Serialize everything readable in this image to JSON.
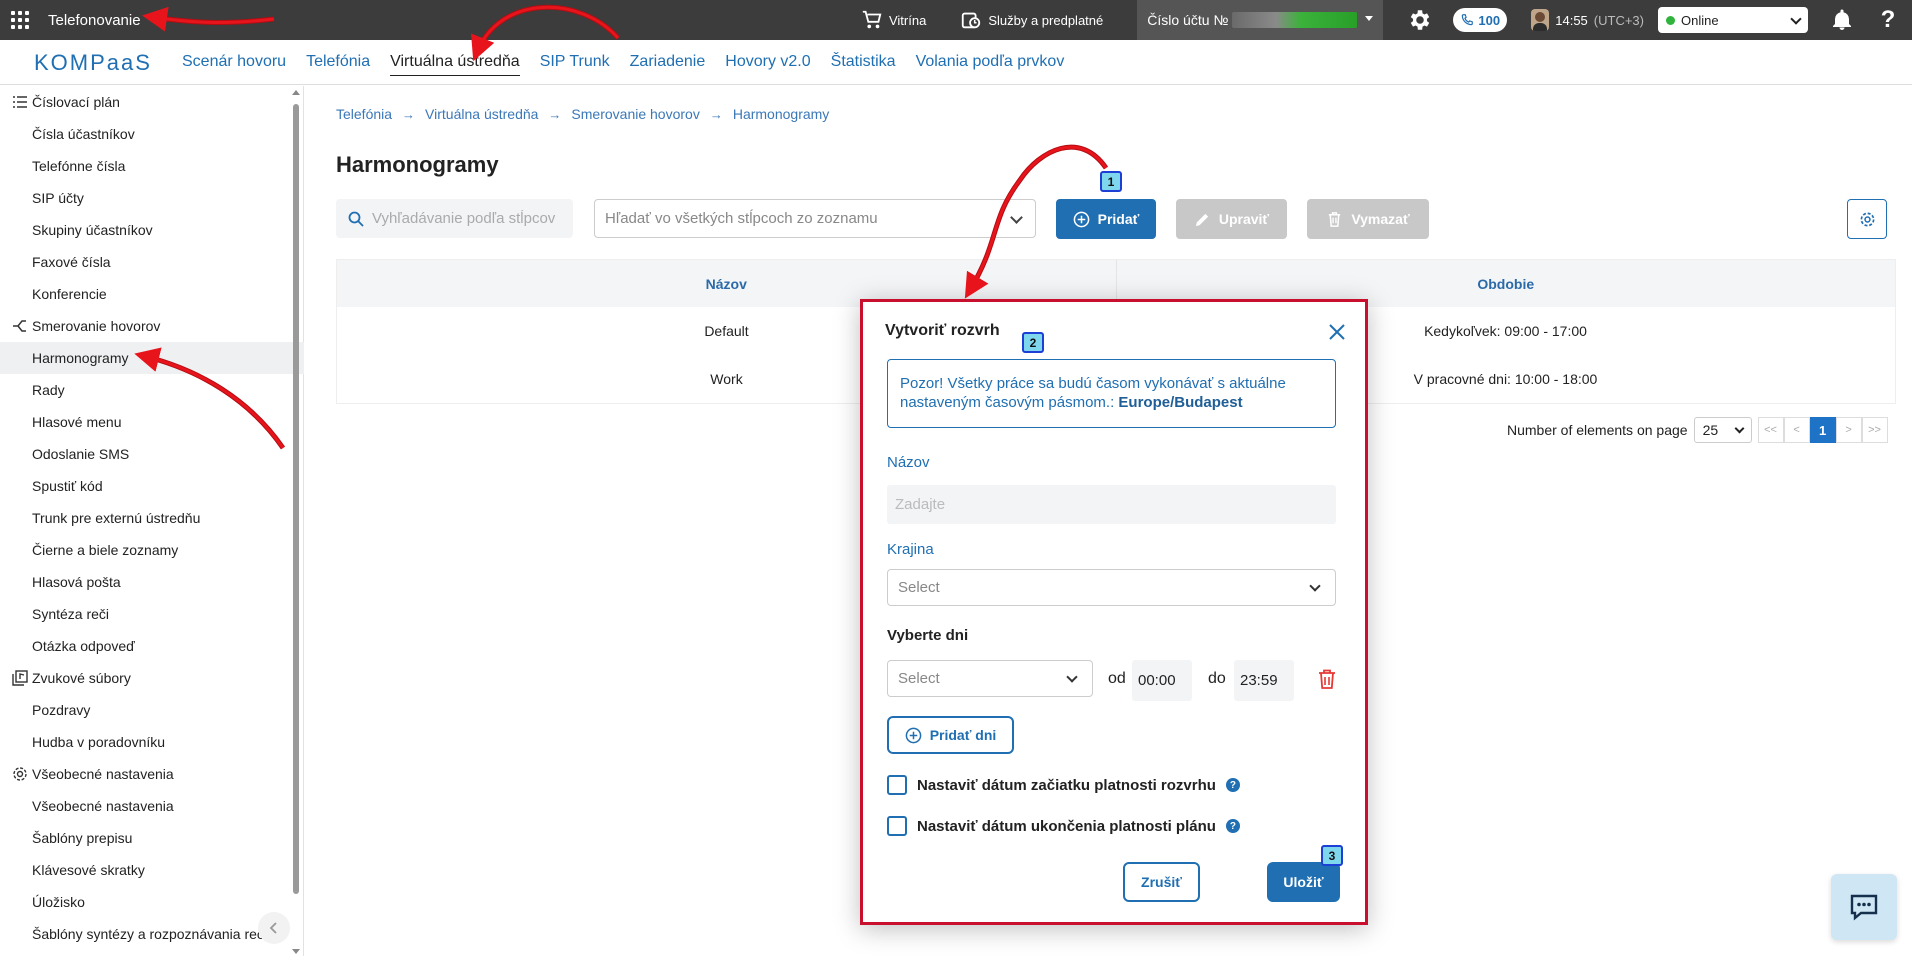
{
  "topbar": {
    "app_title": "Telefonovanie",
    "vitrina": "Vitrína",
    "services": "Služby a predplatné",
    "account_label": "Číslo účtu №",
    "calls_count": "100",
    "time": "14:55",
    "timezone": "(UTC+3)",
    "status": "Online",
    "help": "?"
  },
  "nav": {
    "logo": "KOMPaaS",
    "items": [
      "Scenár hovoru",
      "Telefónia",
      "Virtuálna ústredňa",
      "SIP Trunk",
      "Zariadenie",
      "Hovory v2.0",
      "Štatistika",
      "Volania podľa prvkov"
    ],
    "active_index": 2
  },
  "sidebar": {
    "group_numbering": "Číslovací plán",
    "numbering_items": [
      "Čísla účastníkov",
      "Telefónne čísla",
      "SIP účty",
      "Skupiny účastníkov",
      "Faxové čísla",
      "Konferencie"
    ],
    "group_routing": "Smerovanie hovorov",
    "routing_items": [
      "Harmonogramy",
      "Rady",
      "Hlasové menu",
      "Odoslanie SMS",
      "Spustiť kód",
      "Trunk pre externú ústredňu",
      "Čierne a biele zoznamy",
      "Hlasová pošta",
      "Syntéza reči",
      "Otázka odpoveď"
    ],
    "group_sound": "Zvukové súbory",
    "sound_items": [
      "Pozdravy",
      "Hudba v poradovníku"
    ],
    "group_general": "Všeobecné nastavenia",
    "general_items": [
      "Všeobecné nastavenia",
      "Šablóny prepisu",
      "Klávesové skratky",
      "Úložisko",
      "Šablóny syntézy a rozpoznávania reč."
    ]
  },
  "breadcrumb": [
    "Telefónia",
    "Virtuálna ústredňa",
    "Smerovanie hovorov",
    "Harmonogramy"
  ],
  "page_title": "Harmonogramy",
  "toolbar": {
    "search_placeholder": "Vyhľadávanie podľa stĺpcov",
    "search_all_placeholder": "Hľadať vo všetkých stĺpcoch zo zoznamu",
    "add": "Pridať",
    "edit": "Upraviť",
    "delete": "Vymazať"
  },
  "table": {
    "headers": [
      "Názov",
      "Obdobie"
    ],
    "rows": [
      [
        "Default",
        "Kedykoľvek: 09:00 - 17:00"
      ],
      [
        "Work",
        "V pracovné dni: 10:00 - 18:00"
      ]
    ]
  },
  "pager": {
    "label": "Number of elements on page",
    "page_size": "25",
    "first": "<<",
    "prev": "<",
    "current": "1",
    "next": ">",
    "last": ">>"
  },
  "modal": {
    "title": "Vytvoriť rozvrh",
    "notice_text": "Pozor! Všetky práce sa budú časom vykonávať s aktuálne nastaveným časovým pásmom.:",
    "notice_tz": "Europe/Budapest",
    "name_label": "Názov",
    "name_placeholder": "Zadajte",
    "country_label": "Krajina",
    "country_placeholder": "Select",
    "days_label": "Vyberte dni",
    "day_placeholder": "Select",
    "from_label": "od",
    "from_value": "00:00",
    "to_label": "do",
    "to_value": "23:59",
    "add_days": "Pridať dni",
    "start_date_label": "Nastaviť dátum začiatku platnosti rozvrhu",
    "end_date_label": "Nastaviť dátum ukončenia platnosti plánu",
    "help_mark": "?",
    "cancel": "Zrušiť",
    "save": "Uložiť"
  },
  "steps": [
    "1",
    "2",
    "3"
  ],
  "colors": {
    "accent": "#1f6fb2",
    "topbar": "#3c3c3c",
    "annotation_red": "#e8141c",
    "modal_border": "#c8102e",
    "step_fill": "#7fd7ee"
  }
}
